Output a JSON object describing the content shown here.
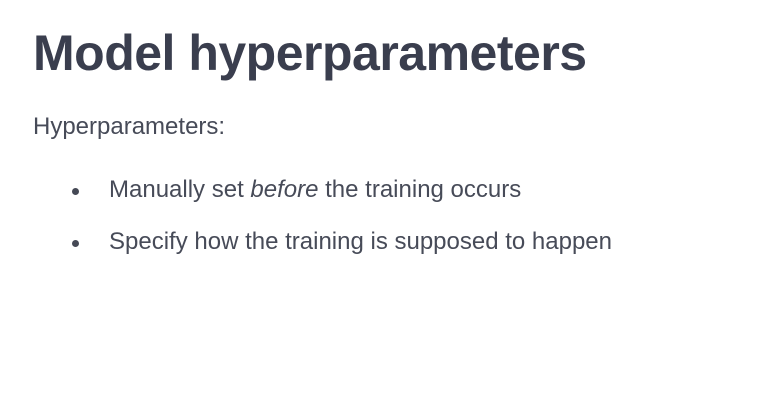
{
  "slide": {
    "title": "Model hyperparameters",
    "intro": "Hyperparameters:",
    "bullets": [
      {
        "before": "Manually set ",
        "emphasis": "before",
        "after": " the training occurs"
      },
      {
        "text": "Specify how the training is supposed to happen"
      }
    ]
  }
}
